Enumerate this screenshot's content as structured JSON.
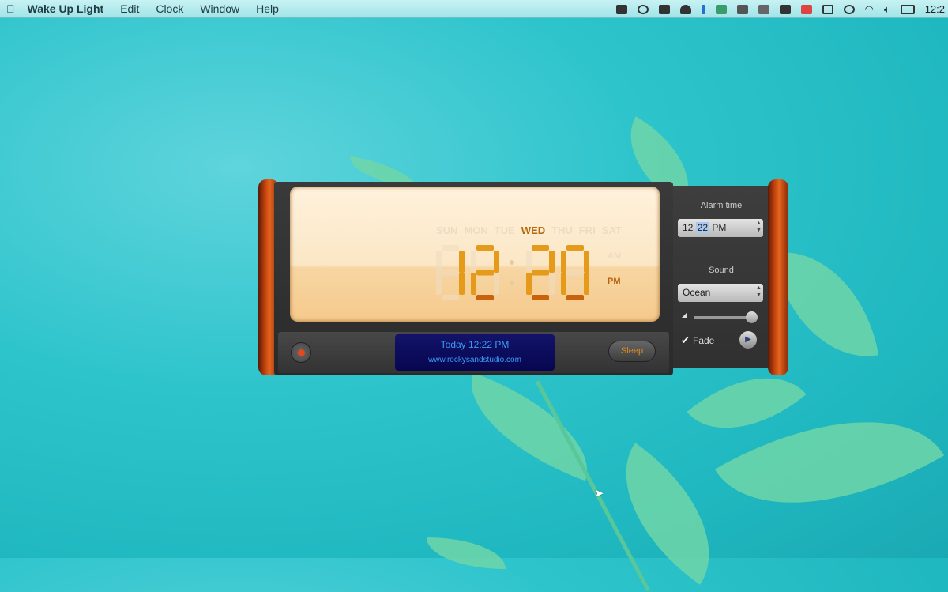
{
  "menubar": {
    "app": "Wake Up Light",
    "items": [
      "Edit",
      "Clock",
      "Window",
      "Help"
    ],
    "clock": "12:2"
  },
  "clock": {
    "days": [
      "SUN",
      "MON",
      "TUE",
      "WED",
      "THU",
      "FRI",
      "SAT"
    ],
    "active_day": "WED",
    "hours": "12",
    "minutes": "20",
    "am": "AM",
    "pm": "PM",
    "period": "PM"
  },
  "status": {
    "line1": "Today 12:22 PM",
    "line2": "www.rockysandstudio.com"
  },
  "buttons": {
    "sleep": "Sleep"
  },
  "panel": {
    "alarm_label": "Alarm time",
    "alarm_hour": "12",
    "alarm_minute": "22",
    "alarm_period": "PM",
    "sound_label": "Sound",
    "sound": "Ocean",
    "volume": 0.95,
    "fade_label": "Fade",
    "fade_checked": true
  },
  "colors": {
    "digit": "#e07a10",
    "lcd_text": "#3a9cf5",
    "wood": "#c8460f"
  }
}
